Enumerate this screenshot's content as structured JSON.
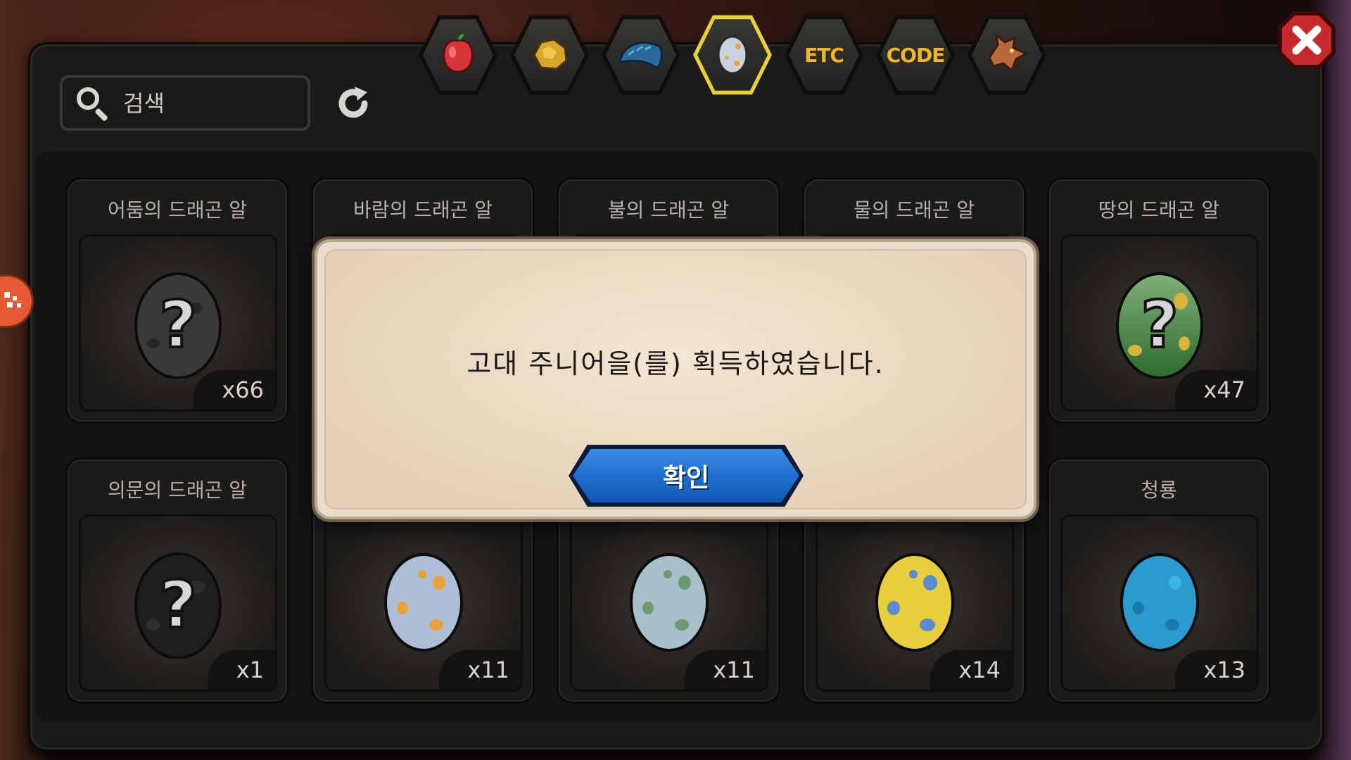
{
  "search": {
    "placeholder": "검색"
  },
  "tabs": [
    {
      "name": "fruit",
      "label": "",
      "active": false,
      "icon": "fruit-icon"
    },
    {
      "name": "gold",
      "label": "",
      "active": false,
      "icon": "gold-icon"
    },
    {
      "name": "dragon-scale",
      "label": "",
      "active": false,
      "icon": "dragon-scale-icon"
    },
    {
      "name": "egg",
      "label": "",
      "active": true,
      "icon": "egg-icon"
    },
    {
      "name": "etc",
      "label": "ETC",
      "active": false
    },
    {
      "name": "code",
      "label": "CODE",
      "active": false
    },
    {
      "name": "dragon",
      "label": "",
      "active": false,
      "icon": "dragon-head-icon"
    }
  ],
  "items": [
    {
      "title": "어둠의 드래곤 알",
      "count": "x66",
      "egg": "mystery-dark"
    },
    {
      "title": "바람의 드래곤 알",
      "count": "",
      "egg": "hidden"
    },
    {
      "title": "불의 드래곤 알",
      "count": "",
      "egg": "hidden"
    },
    {
      "title": "물의 드래곤 알",
      "count": "",
      "egg": "hidden"
    },
    {
      "title": "땅의 드래곤 알",
      "count": "x47",
      "egg": "mystery-green"
    },
    {
      "title": "의문의 드래곤 알",
      "count": "x1",
      "egg": "mystery-black"
    },
    {
      "title": "",
      "count": "x11",
      "egg": "blue-orange"
    },
    {
      "title": "",
      "count": "x11",
      "egg": "blue-green"
    },
    {
      "title": "",
      "count": "x14",
      "egg": "yellow-blue"
    },
    {
      "title": "청룡",
      "count": "x13",
      "egg": "cyan"
    }
  ],
  "dialog": {
    "message": "고대 주니어을(를) 획득하였습니다.",
    "confirm_label": "확인"
  },
  "colors": {
    "accent_tab": "#e8d23a",
    "confirm_blue": "#1f6fd0",
    "close_red": "#c42a2a"
  }
}
